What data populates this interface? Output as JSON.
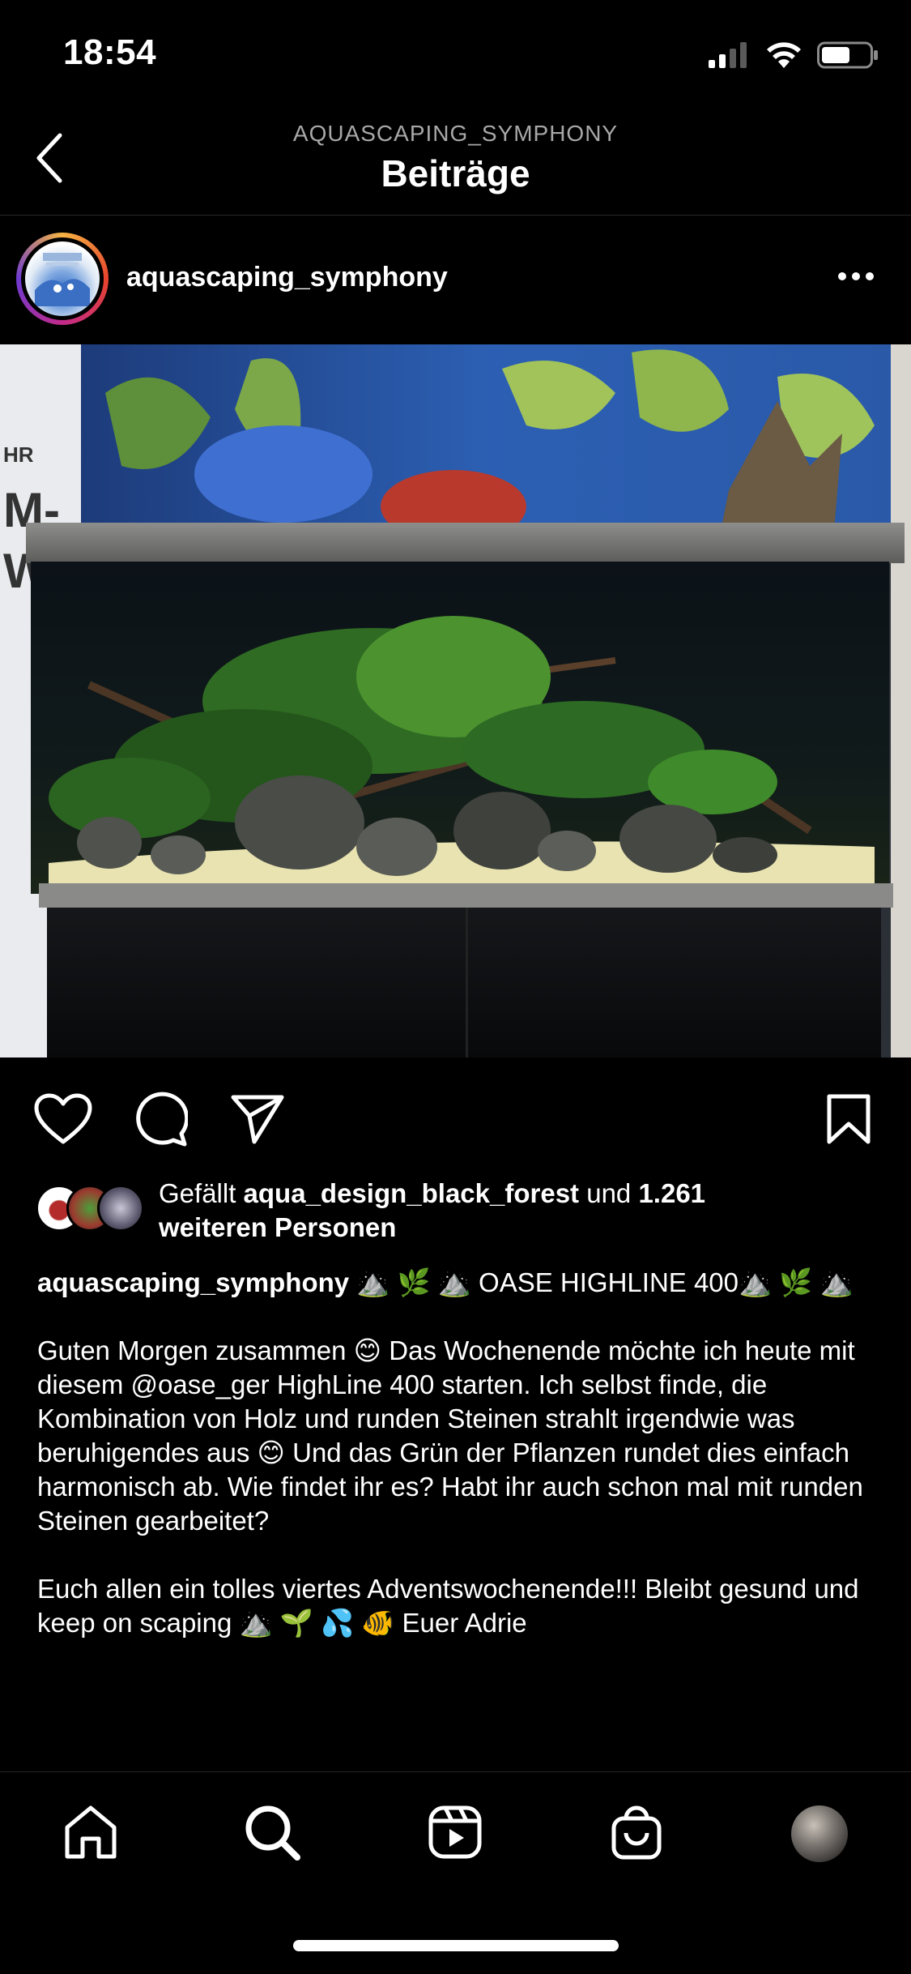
{
  "status_bar": {
    "time": "18:54",
    "icons": [
      "signal-icon",
      "wifi-icon",
      "battery-icon"
    ]
  },
  "header": {
    "subtitle": "AQUASCAPING_SYMPHONY",
    "title": "Beiträge"
  },
  "post": {
    "username": "aquascaping_symphony",
    "likes": {
      "prefix": "Gefällt ",
      "liked_by": "aqua_design_black_forest",
      "middle": " und ",
      "count": "1.261",
      "suffix": "weiteren Personen"
    },
    "caption": {
      "username": "aquascaping_symphony",
      "headline": "⛰️ 🌿 ⛰️ OASE HIGHLINE 400⛰️ 🌿 ⛰️",
      "paragraph1": "Guten Morgen zusammen 😊 Das Wochenende möchte ich heute mit diesem @oase_ger HighLine 400 starten. Ich selbst finde, die Kombination von Holz und runden Steinen strahlt irgendwie was beruhigendes aus 😊 Und das Grün der Pflanzen rundet dies einfach harmonisch ab. Wie findet ihr es? Habt ihr auch schon mal mit runden Steinen gearbeitet?",
      "paragraph2": "Euch allen ein tolles viertes Adventswochenende!!! Bleibt gesund und keep on scaping ⛰️ 🌱 💦 🐠 Euer Adrie"
    },
    "image_wall_text": [
      "HR",
      "M-",
      "W"
    ]
  },
  "tab_bar": {
    "items": [
      "home-icon",
      "search-icon",
      "reels-icon",
      "shop-icon",
      "profile-avatar"
    ]
  },
  "colors": {
    "background": "#000000",
    "text": "#ffffff",
    "muted": "#a8a8a8"
  }
}
